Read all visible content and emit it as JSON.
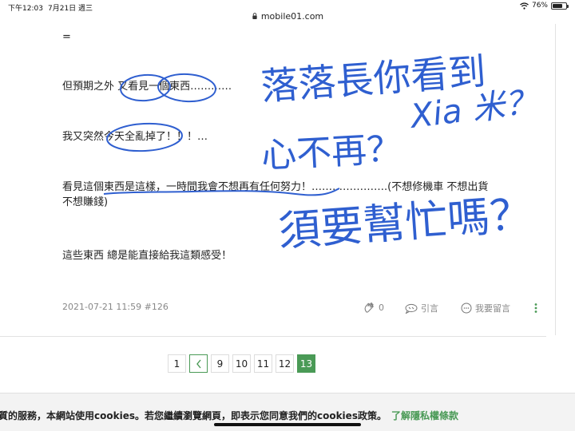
{
  "status_bar": {
    "time": "下午12:03",
    "date": "7月21日 週三",
    "battery": "76%",
    "battery_level": 0.76
  },
  "url_bar": {
    "host": "mobile01.com"
  },
  "post": {
    "lines": [
      "=",
      "但預期之外 又看見一個東西…………",
      "我又突然今天全亂掉了！！！…",
      "看見這個東西是這樣，一時間我會不想再有任何努力！………………….(不想修機車 不想出貨",
      "不想賺錢)",
      "這些東西 總是能直接給我這類感受！"
    ],
    "timestamp": "2021-07-21 11:59 #126",
    "like_count": "0",
    "quote_label": "引言",
    "reply_label": "我要留言"
  },
  "handwriting": {
    "line1": "落落長你看到",
    "line2": "Xia 米？",
    "line3": "心不再？",
    "line4": "須要幫忙嗎？",
    "ink_color": "#2f5fd0"
  },
  "pagination": {
    "prev_symbol": "<",
    "pages": [
      "1",
      "9",
      "10",
      "11",
      "12",
      "13"
    ],
    "current": "13"
  },
  "cookie_banner": {
    "text": "質的服務，本網站使用cookies。若您繼續瀏覽網頁，即表示您同意我們的cookies政策。",
    "link": "了解隱私權條款"
  },
  "colors": {
    "accent_green": "#4a9a56",
    "ink_blue": "#2f5fd0"
  }
}
